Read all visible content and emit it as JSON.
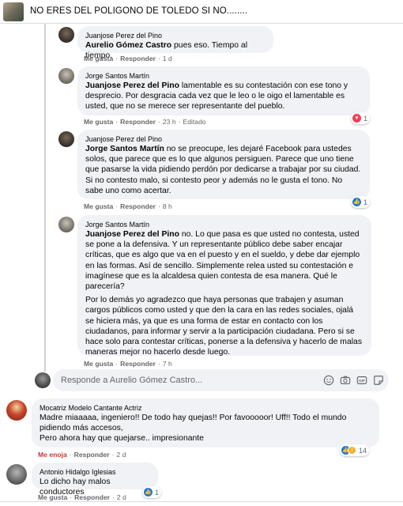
{
  "header": {
    "title": "NO ERES DEL POLIGONO DE TOLEDO SI NO........"
  },
  "comments": [
    {
      "author": "Juanjose Perez del Pino",
      "mention": "Aurelio Gómez Castro",
      "paragraphs": [
        " pues eso. Tiempo al tiempo."
      ],
      "like_label": "Me gusta",
      "reply_label": "Responder",
      "time": "1 d"
    },
    {
      "author": "Jorge Santos Martín",
      "mention": "Juanjose Perez del Pino",
      "paragraphs": [
        " lamentable es su contestación con ese tono y desprecio. Por desgracia cada vez que le leo o le oigo el lamentable es usted, que no se merece ser representante del pueblo."
      ],
      "like_label": "Me gusta",
      "reply_label": "Responder",
      "time": "23 h",
      "edited": "Editado",
      "reaction_count": "1"
    },
    {
      "author": "Juanjose Perez del Pino",
      "mention": "Jorge Santos Martín",
      "paragraphs": [
        " no se preocupe, les dejaré Facebook para ustedes solos, que parece que es lo que algunos persiguen. Parece que uno tiene que pasarse la vida pidiendo perdón por dedicarse a trabajar por su ciudad. Si no contesto malo, si contesto peor y además no le gusta el tono. No sabe uno como acertar."
      ],
      "like_label": "Me gusta",
      "reply_label": "Responder",
      "time": "8 h",
      "reaction_count": "1"
    },
    {
      "author": "Jorge Santos Martín",
      "mention": "Juanjose Perez del Pino",
      "paragraphs": [
        " no. Lo que pasa es que usted no contesta, usted se pone a la defensiva. Y un representante público debe saber encajar críticas, que es algo que va en el puesto y en el sueldo, y debe dar ejemplo en las formas. Así de sencillo. Simplemente relea usted su contestación e imagínese que es la alcaldesa quien contesta de esa manera. Qué le parecería?",
        "Por lo demás yo agradezco que haya personas que trabajen y asuman cargos públicos como usted y que den la cara en las redes sociales, ojalá se hiciera más, ya que es una forma de estar en contacto con los ciudadanos, para informar y servir a la participación ciudadana. Pero si se hace solo para contestar críticas, ponerse a la defensiva y hacerlo de malas maneras mejor no hacerlo desde luego."
      ],
      "like_label": "Me gusta",
      "reply_label": "Responder",
      "time": "7 h"
    }
  ],
  "reply_box": {
    "placeholder": "Responde a Aurelio Gómez Castro..."
  },
  "top_comments": [
    {
      "author": "Mocatriz Modelo Cantante Actriz",
      "paragraphs": [
        "Madre miaaaaa, ingeniero!! De todo hay quejas!! Por favooooor! Uff!! Todo el mundo pidiendo más accesos,",
        "Pero ahora hay que quejarse.. impresionante"
      ],
      "like_label": "Me enoja",
      "reply_label": "Responder",
      "time": "2 d",
      "reaction_count": "14"
    },
    {
      "author": "Antonio Hidalgo Iglesias",
      "paragraphs": [
        "Lo dicho hay malos conductores"
      ],
      "like_label": "Me gusta",
      "reply_label": "Responder",
      "time": "2 d",
      "reaction_count": "1"
    }
  ],
  "colors": {
    "bubble": "#f0f2f5",
    "meta": "#65676b",
    "like": "#1877f2",
    "love": "#f33e58",
    "angry": "#d1342f"
  }
}
